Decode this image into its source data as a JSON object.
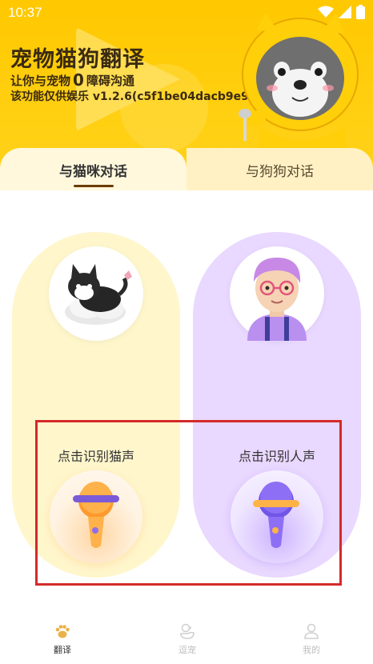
{
  "status_bar": {
    "time": "10:37",
    "icons": [
      "wifi-icon",
      "signal-icon",
      "battery-icon"
    ]
  },
  "header": {
    "title": "宠物猫狗翻译",
    "slogan_prefix": "让你与宠物",
    "slogan_zero": "0",
    "slogan_suffix": "障碍沟通",
    "disclaimer": "该功能仅供娱乐 v1.2.6(c5f1be04dacb9e98)"
  },
  "tabs": [
    {
      "label": "与猫咪对话",
      "active": true
    },
    {
      "label": "与狗狗对话",
      "active": false
    }
  ],
  "cards": {
    "cat": {
      "label": "点击识别猫声",
      "icon": "microphone-icon"
    },
    "human": {
      "label": "点击识别人声",
      "icon": "microphone-icon"
    }
  },
  "bottom_nav": [
    {
      "label": "翻译",
      "icon": "paw-icon",
      "active": true
    },
    {
      "label": "逗宠",
      "icon": "duck-icon",
      "active": false
    },
    {
      "label": "我的",
      "icon": "user-icon",
      "active": false
    }
  ],
  "colors": {
    "header_yellow": "#ffc800",
    "cat_card": "#fff6cc",
    "dog_card": "#e9d8ff",
    "highlight_border": "#d42a2a",
    "active_nav": "#333333",
    "inactive_nav": "#bdbdbd"
  }
}
